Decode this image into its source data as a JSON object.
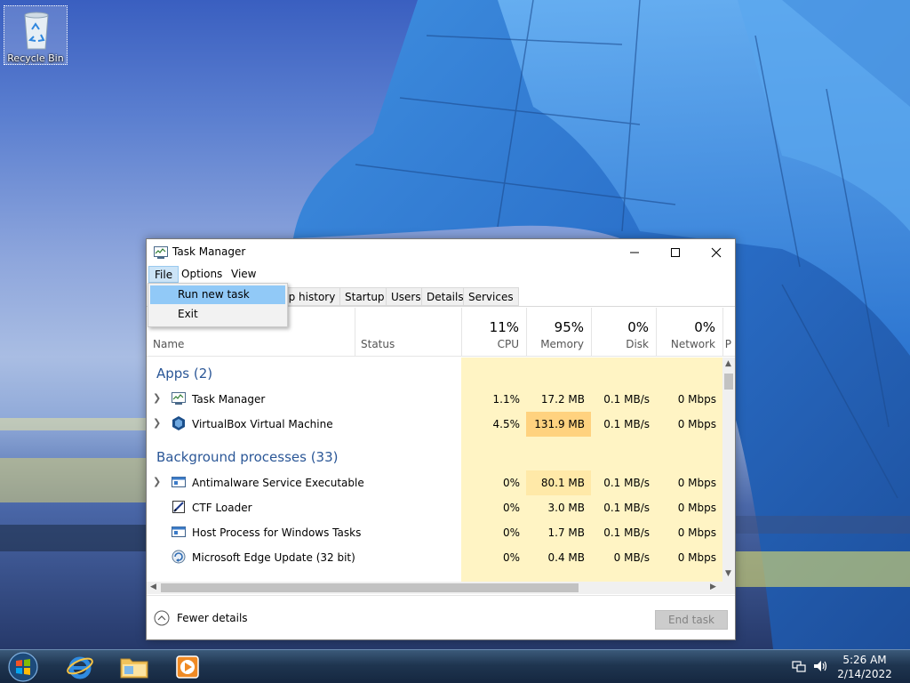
{
  "desktop": {
    "recycle_bin_label": "Recycle Bin"
  },
  "window": {
    "title": "Task Manager",
    "menu": {
      "file": "File",
      "options": "Options",
      "view": "View"
    },
    "file_menu_items": {
      "run_new_task": "Run new task",
      "exit": "Exit"
    },
    "tabs": {
      "app_history": "pp history",
      "startup": "Startup",
      "users": "Users",
      "details": "Details",
      "services": "Services"
    },
    "columns": {
      "name": "Name",
      "status": "Status",
      "cpu_pct": "11%",
      "cpu_label": "CPU",
      "memory_pct": "95%",
      "memory_label": "Memory",
      "disk_pct": "0%",
      "disk_label": "Disk",
      "network_pct": "0%",
      "network_label": "Network",
      "overflow_label": "P"
    },
    "groups": {
      "apps": "Apps (2)",
      "background": "Background processes (33)"
    },
    "apps": [
      {
        "name": "Task Manager",
        "cpu": "1.1%",
        "memory": "17.2 MB",
        "disk": "0.1 MB/s",
        "network": "0 Mbps"
      },
      {
        "name": "VirtualBox Virtual Machine",
        "cpu": "4.5%",
        "memory": "131.9 MB",
        "disk": "0.1 MB/s",
        "network": "0 Mbps"
      }
    ],
    "background": [
      {
        "name": "Antimalware Service Executable",
        "cpu": "0%",
        "memory": "80.1 MB",
        "disk": "0.1 MB/s",
        "network": "0 Mbps"
      },
      {
        "name": "CTF Loader",
        "cpu": "0%",
        "memory": "3.0 MB",
        "disk": "0.1 MB/s",
        "network": "0 Mbps"
      },
      {
        "name": "Host Process for Windows Tasks",
        "cpu": "0%",
        "memory": "1.7 MB",
        "disk": "0.1 MB/s",
        "network": "0 Mbps"
      },
      {
        "name": "Microsoft Edge Update (32 bit)",
        "cpu": "0%",
        "memory": "0.4 MB",
        "disk": "0 MB/s",
        "network": "0 Mbps"
      }
    ],
    "footer": {
      "fewer_details": "Fewer details",
      "end_task": "End task"
    }
  },
  "taskbar": {
    "time": "5:26 AM",
    "date": "2/14/2022"
  },
  "colors": {
    "heat_light": "#fff4c4",
    "heat_hot": "#ffd27f",
    "group_title": "#2b5797",
    "menu_highlight": "#91c9f7"
  }
}
